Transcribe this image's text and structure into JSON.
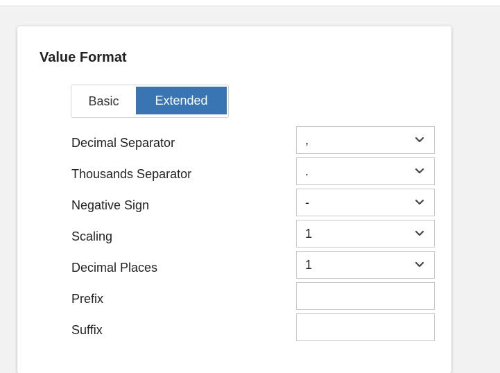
{
  "panel": {
    "title": "Value Format"
  },
  "mode_toggle": {
    "basic_label": "Basic",
    "extended_label": "Extended",
    "selected": "Extended"
  },
  "fields": [
    {
      "label": "Decimal Separator",
      "type": "select",
      "value": ","
    },
    {
      "label": "Thousands Separator",
      "type": "select",
      "value": "."
    },
    {
      "label": "Negative Sign",
      "type": "select",
      "value": "-"
    },
    {
      "label": "Scaling",
      "type": "select",
      "value": "1"
    },
    {
      "label": "Decimal Places",
      "type": "select",
      "value": "1"
    },
    {
      "label": "Prefix",
      "type": "text",
      "value": ""
    },
    {
      "label": "Suffix",
      "type": "text",
      "value": ""
    }
  ],
  "icons": {
    "dropdown": "chevron-down-icon"
  },
  "colors": {
    "accent": "#3a75b3",
    "panel_bg": "#ffffff",
    "page_bg": "#f2f2f2",
    "border": "#c8c8c8"
  }
}
